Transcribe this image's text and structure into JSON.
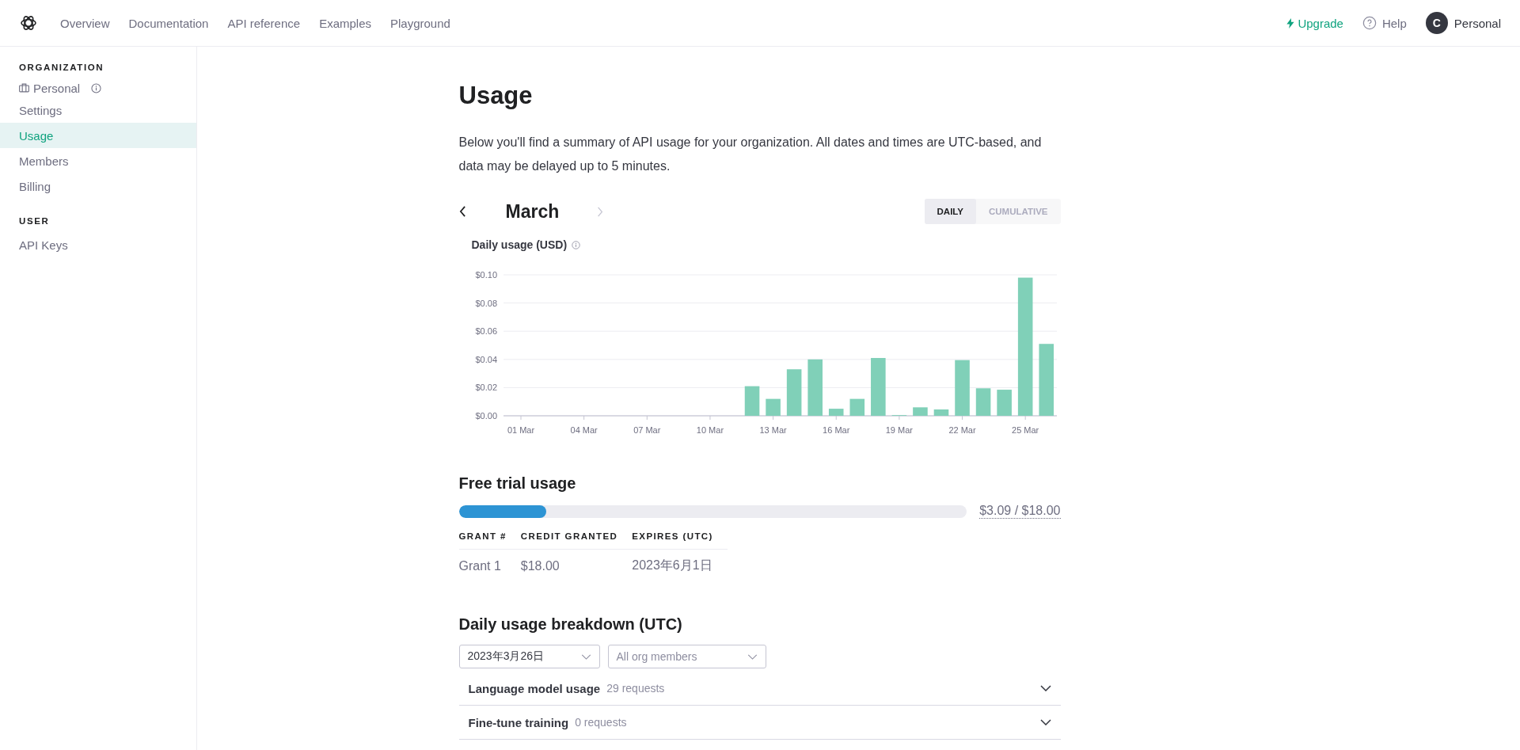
{
  "top_nav": {
    "links": [
      {
        "label": "Overview",
        "selected": false
      },
      {
        "label": "Documentation",
        "selected": false
      },
      {
        "label": "API reference",
        "selected": false
      },
      {
        "label": "Examples",
        "selected": false
      },
      {
        "label": "Playground",
        "selected": false
      }
    ],
    "upgrade": "Upgrade",
    "help": "Help",
    "avatar_initial": "C",
    "account": "Personal"
  },
  "sidebar": {
    "sections": [
      {
        "heading": "ORGANIZATION",
        "items": [
          {
            "label": "Personal",
            "kind": "org",
            "selected": false
          },
          {
            "label": "Settings",
            "kind": "link",
            "selected": false
          },
          {
            "label": "Usage",
            "kind": "link",
            "selected": true
          },
          {
            "label": "Members",
            "kind": "link",
            "selected": false
          },
          {
            "label": "Billing",
            "kind": "link",
            "selected": false
          }
        ]
      },
      {
        "heading": "USER",
        "items": [
          {
            "label": "API Keys",
            "kind": "link",
            "selected": false
          }
        ]
      }
    ]
  },
  "page": {
    "title": "Usage",
    "description": "Below you'll find a summary of API usage for your organization. All dates and times are UTC-based, and data may be delayed up to 5 minutes.",
    "month": "March",
    "view_toggle": [
      {
        "label": "DAILY",
        "selected": true
      },
      {
        "label": "CUMULATIVE",
        "selected": false
      }
    ],
    "chart_data": {
      "type": "bar",
      "title": "Daily usage (USD)",
      "grid": true,
      "categories": [
        "01 Mar",
        null,
        null,
        "04 Mar",
        null,
        null,
        "07 Mar",
        null,
        null,
        "10 Mar",
        null,
        null,
        "13 Mar",
        null,
        null,
        "16 Mar",
        null,
        null,
        "19 Mar",
        null,
        null,
        "22 Mar",
        null,
        null,
        "25 Mar",
        null
      ],
      "series": [
        {
          "color": "#80d0b8",
          "values": [
            0,
            0,
            0,
            0,
            0,
            0,
            0,
            0,
            0,
            0,
            0,
            0.021,
            0.012,
            0.033,
            0.04,
            0.005,
            0.012,
            0.041,
            0.0005,
            0.006,
            0.0045,
            0.0395,
            0.0195,
            0.0185,
            0.098,
            0.051
          ]
        }
      ],
      "ylim": [
        0,
        0.1
      ],
      "yticks": [
        {
          "value": 0,
          "label": "$0.00"
        },
        {
          "value": 0.02,
          "label": "$0.02"
        },
        {
          "value": 0.04,
          "label": "$0.04"
        },
        {
          "value": 0.06,
          "label": "$0.06"
        },
        {
          "value": 0.08,
          "label": "$0.08"
        },
        {
          "value": 0.1,
          "label": "$0.10"
        }
      ]
    },
    "free_trial": {
      "title": "Free trial usage",
      "level": 0.172,
      "amount": "$3.09 / $18.00",
      "columns": [
        "GRANT #",
        "CREDIT GRANTED",
        "EXPIRES (UTC)"
      ],
      "rows": [
        [
          "Grant 1",
          "$18.00",
          "2023年6月1日"
        ]
      ]
    },
    "breakdown": {
      "title": "Daily usage breakdown (UTC)",
      "date_select": "2023年3月26日",
      "member_select_placeholder": "All org members",
      "sections": [
        {
          "name": "Language model usage",
          "count": "29 requests",
          "expanded": false
        },
        {
          "name": "Fine-tune training",
          "count": "0 requests",
          "expanded": false
        }
      ]
    }
  }
}
